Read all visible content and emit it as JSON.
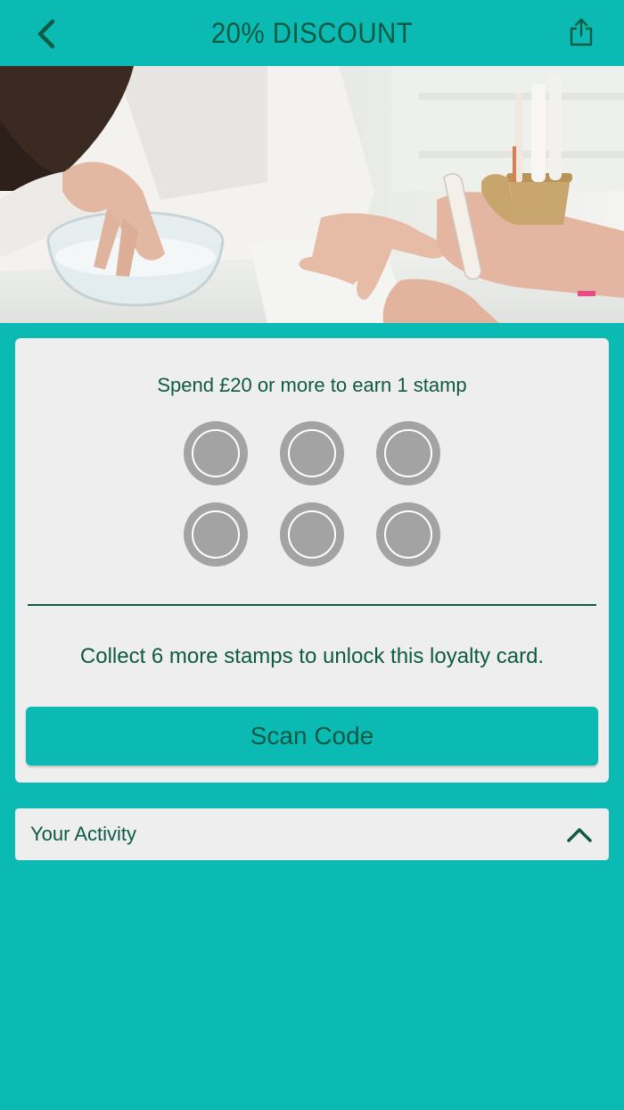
{
  "header": {
    "title": "20% DISCOUNT",
    "back_icon": "chevron-left-icon",
    "share_icon": "share-icon"
  },
  "hero": {
    "image": "manicure-photo"
  },
  "loyalty_card": {
    "spend_text": "Spend £20 or more to earn 1 stamp",
    "stamps_total": 6,
    "stamps_collected": 0,
    "collect_text": "Collect 6 more stamps to unlock this loyalty card.",
    "scan_button_label": "Scan Code"
  },
  "activity": {
    "label": "Your Activity",
    "toggle_icon": "chevron-up-icon"
  },
  "colors": {
    "accent": "#0cbab4",
    "text": "#0e5a45",
    "card_bg": "#eeeeee",
    "stamp": "#a3a3a3"
  }
}
